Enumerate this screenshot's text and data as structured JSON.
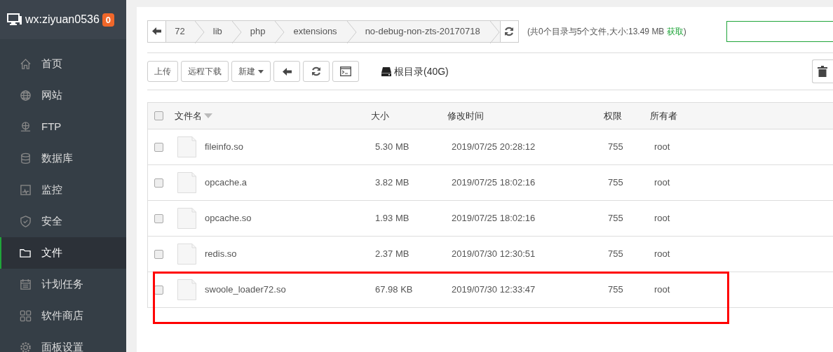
{
  "sidebar": {
    "title": "wx:ziyuan0536",
    "badge": "0",
    "items": [
      {
        "label": "首页",
        "selected": false
      },
      {
        "label": "网站",
        "selected": false
      },
      {
        "label": "FTP",
        "selected": false
      },
      {
        "label": "数据库",
        "selected": false
      },
      {
        "label": "监控",
        "selected": false
      },
      {
        "label": "安全",
        "selected": false
      },
      {
        "label": "文件",
        "selected": true
      },
      {
        "label": "计划任务",
        "selected": false
      },
      {
        "label": "软件商店",
        "selected": false
      },
      {
        "label": "面板设置",
        "selected": false
      }
    ]
  },
  "breadcrumb": [
    "72",
    "lib",
    "php",
    "extensions",
    "no-debug-non-zts-20170718"
  ],
  "summary": {
    "text": "(共0个目录与5个文件,大小:13.49 MB",
    "link": "获取",
    "close": ")"
  },
  "toolbar": {
    "buttons": [
      {
        "kind": "text",
        "label": "上传"
      },
      {
        "kind": "text",
        "label": "远程下载"
      },
      {
        "kind": "dropdown",
        "label": "新建"
      },
      {
        "kind": "back"
      },
      {
        "kind": "refresh"
      },
      {
        "kind": "terminal"
      }
    ],
    "disk": "根目录(40G)"
  },
  "table": {
    "select_all_checked": false,
    "columns": [
      "文件名",
      "大小",
      "修改时间",
      "权限",
      "所有者"
    ],
    "rows": [
      {
        "name": "fileinfo.so",
        "size": "5.30 MB",
        "modified": "2019/07/25 20:28:12",
        "permissions": "755",
        "owner": "root",
        "checked": false,
        "highlighted": false
      },
      {
        "name": "opcache.a",
        "size": "3.82 MB",
        "modified": "2019/07/25 18:02:16",
        "permissions": "755",
        "owner": "root",
        "checked": false,
        "highlighted": false
      },
      {
        "name": "opcache.so",
        "size": "1.93 MB",
        "modified": "2019/07/25 18:02:16",
        "permissions": "755",
        "owner": "root",
        "checked": false,
        "highlighted": false
      },
      {
        "name": "redis.so",
        "size": "2.37 MB",
        "modified": "2019/07/30 12:30:51",
        "permissions": "755",
        "owner": "root",
        "checked": false,
        "highlighted": false
      },
      {
        "name": "swoole_loader72.so",
        "size": "67.98 KB",
        "modified": "2019/07/30 12:33:47",
        "permissions": "755",
        "owner": "root",
        "checked": false,
        "highlighted": true
      }
    ]
  }
}
